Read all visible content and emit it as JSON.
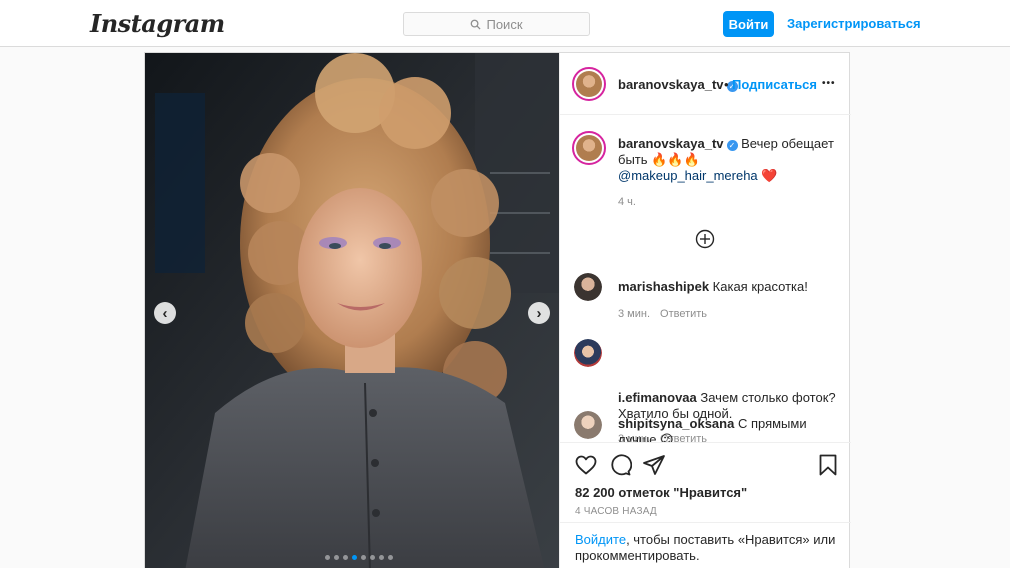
{
  "header": {
    "logo": "Instagram",
    "search_placeholder": "Поиск",
    "login_label": "Войти",
    "signup_label": "Зарегистрироваться"
  },
  "post": {
    "author": "baranovskaya_tv",
    "separator": "•",
    "follow_label": "Подписаться",
    "more_label": "•••",
    "caption": {
      "user": "baranovskaya_tv",
      "text": "Вечер обещает быть 🔥🔥🔥",
      "mention": "@makeup_hair_mereha",
      "emoji": "❤️",
      "time": "4 ч."
    },
    "comments": [
      {
        "user": "marishashipek",
        "text": "Какая красотка!",
        "time": "3 мин.",
        "reply": "Ответить"
      },
      {
        "user": "i.efimanovaa",
        "text": "Зачем столько фоток? Хватило бы одной.",
        "time": "3 мин.",
        "reply": "Ответить"
      },
      {
        "user": "shipitsyna_oksana",
        "text": "С прямыми лучше",
        "emoji": "😉"
      }
    ],
    "likes": "82 200 отметок \"Нравится\"",
    "posted": "4 ЧАСОВ НАЗАД",
    "login_prompt": {
      "link": "Войдите",
      "text": ", чтобы поставить «Нравится» или прокомментировать."
    },
    "carousel": {
      "total": 8,
      "active": 3
    }
  },
  "icons": {
    "search": "search-icon",
    "verified": "verified-badge-icon",
    "load_more": "plus-circle-icon",
    "like": "heart-icon",
    "comment": "comment-bubble-icon",
    "share": "share-plane-icon",
    "save": "bookmark-icon",
    "prev": "chevron-left-icon",
    "next": "chevron-right-icon"
  },
  "colors": {
    "accent": "#0095f6",
    "border": "#dbdbdb",
    "muted": "#8e8e8e",
    "text": "#262626"
  }
}
